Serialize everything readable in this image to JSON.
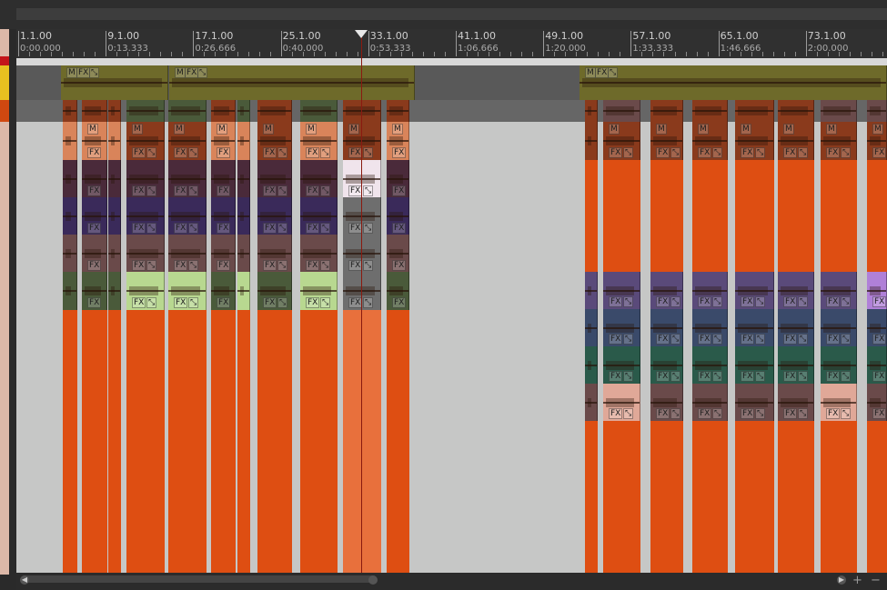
{
  "ruler": {
    "markers": [
      {
        "bar": "1.1.00",
        "time": "0:00.000"
      },
      {
        "bar": "9.1.00",
        "time": "0:13.333"
      },
      {
        "bar": "17.1.00",
        "time": "0:26.666"
      },
      {
        "bar": "25.1.00",
        "time": "0:40.000"
      },
      {
        "bar": "33.1.00",
        "time": "0:53.333"
      },
      {
        "bar": "41.1.00",
        "time": "1:06.666"
      },
      {
        "bar": "49.1.00",
        "time": "1:20.000"
      },
      {
        "bar": "57.1.00",
        "time": "1:33.333"
      },
      {
        "bar": "65.1.00",
        "time": "1:46.666"
      },
      {
        "bar": "73.1.00",
        "time": "2:00.000"
      }
    ]
  },
  "badges": {
    "mute": "M",
    "fx": "FX",
    "env": "⤡"
  },
  "colors": {
    "orange": "#de4e12",
    "olive": "#6e6a2a",
    "rust": "#8a3a1c",
    "salmon": "#d9845a",
    "plum": "#4a2a3a",
    "indigo": "#3a2a5a",
    "mauve": "#6a4a4a",
    "moss": "#4a5a3a",
    "lime": "#b8d890",
    "violet": "#5a4a7a",
    "slate": "#3a4a6a",
    "teal": "#2a5a4a",
    "pink": "#e0a898"
  },
  "scrollbar": {
    "left_icon": "◀",
    "right_icon": "▶",
    "zoom_in": "+",
    "zoom_out": "−"
  }
}
